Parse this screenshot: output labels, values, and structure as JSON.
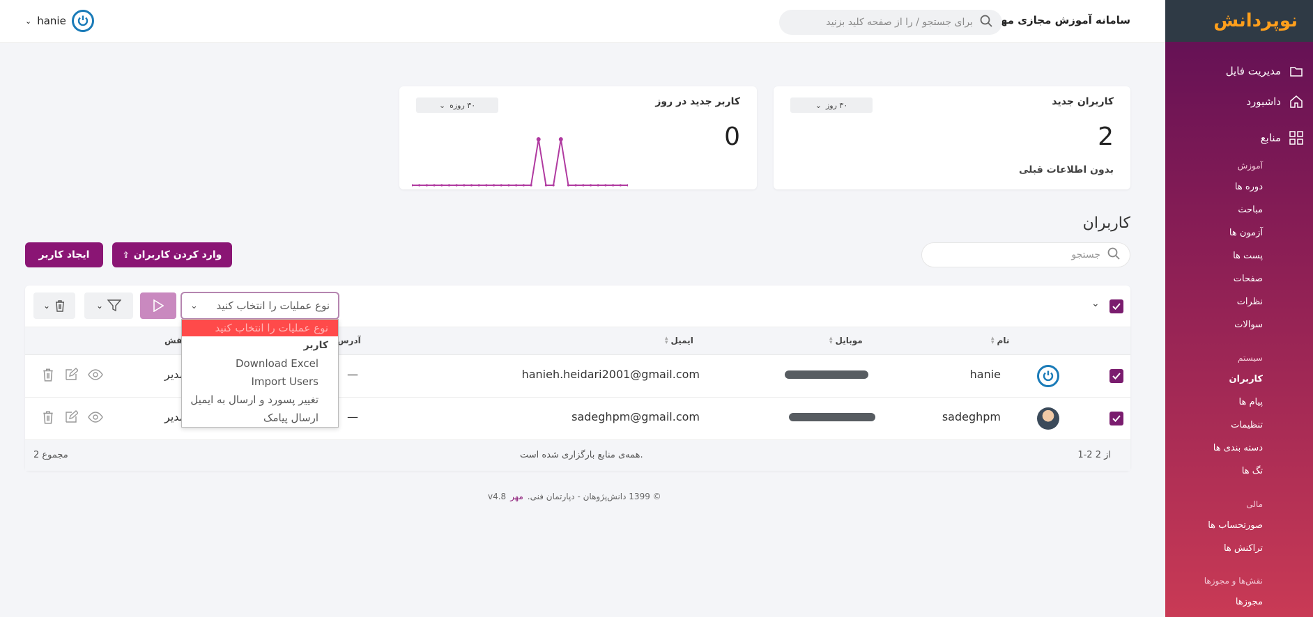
{
  "sidebar": {
    "logo_text": "نوپردانش",
    "main": [
      {
        "label": "مدیریت فایل",
        "icon": "folder-icon"
      },
      {
        "label": "داشبورد",
        "icon": "home-icon"
      },
      {
        "label": "منابع",
        "icon": "grid-icon"
      }
    ],
    "groups": [
      {
        "heading": "آموزش",
        "items": [
          "دوره ها",
          "مباحث",
          "آزمون ها",
          "پست ها",
          "صفحات",
          "نظرات",
          "سوالات"
        ]
      },
      {
        "heading": "سیستم",
        "items": [
          "کاربران",
          "پیام ها",
          "تنظیمات",
          "دسته بندی ها",
          "تگ ها"
        ]
      },
      {
        "heading": "مالی",
        "items": [
          "صورتحساب ها",
          "تراکنش ها"
        ]
      },
      {
        "heading": "نقش‌ها و مجوزها",
        "items": [
          "مجوزها"
        ]
      }
    ],
    "active_item": "کاربران"
  },
  "header": {
    "site_title": "سامانه آموزش مجازی مهر",
    "search_placeholder": "برای جستجو / را از صفحه کلید بزنید",
    "username": "hanie"
  },
  "stats": {
    "new_users": {
      "title": "کاربران جدید",
      "value": "2",
      "subtitle": "بدون اطلاعات قبلی",
      "period": "۳۰ روز"
    },
    "daily_users": {
      "title": "کاربر جدید در روز",
      "value": "0",
      "period": "۳۰ روزه"
    }
  },
  "chart_data": {
    "type": "line",
    "title": "کاربر جدید در روز",
    "x": [
      1,
      2,
      3,
      4,
      5,
      6,
      7,
      8,
      9,
      10,
      11,
      12,
      13,
      14,
      15,
      16,
      17,
      18,
      19,
      20,
      21,
      22,
      23,
      24,
      25,
      26,
      27,
      28,
      29,
      30
    ],
    "series": [
      {
        "values": [
          0,
          0,
          0,
          0,
          0,
          0,
          0,
          0,
          0,
          0,
          0,
          0,
          0,
          0,
          0,
          0,
          0,
          1,
          0,
          0,
          1,
          0,
          0,
          0,
          0,
          0,
          0,
          0,
          0,
          0
        ]
      }
    ],
    "color": "#b03aa0",
    "ylim": [
      0,
      1
    ]
  },
  "users_section": {
    "title": "کاربران",
    "search_placeholder": "جستجو",
    "create_button": "ایجاد کاربر",
    "import_button": "وارد کردن کاربران",
    "ops_placeholder": "نوع عملیات را انتخاب کنید"
  },
  "table": {
    "columns": {
      "name": "نام",
      "mobile": "موبایل",
      "email": "ایمیل",
      "address": "آدرس",
      "role": "نقش"
    },
    "rows": [
      {
        "name": "hanie",
        "email": "hanieh.heidari2001@gmail.com",
        "address": "—",
        "role": "مدیر"
      },
      {
        "name": "sadeghpm",
        "email": "sadeghpm@gmail.com",
        "address": "—",
        "role": "مدیر"
      }
    ],
    "range": "1-2 از 2",
    "loaded_text": "همه‌ی منابع بارگزاری شده است.",
    "total": "مجموع 2"
  },
  "dropdown": {
    "items": [
      {
        "label": "نوع عملیات را انتخاب کنید",
        "kind": "placeholder"
      },
      {
        "label": "کاربر",
        "kind": "group"
      },
      {
        "label": "Download Excel",
        "kind": "option"
      },
      {
        "label": "Import Users",
        "kind": "option"
      },
      {
        "label": "تغییر پسورد و ارسال به ایمیل",
        "kind": "option"
      },
      {
        "label": "ارسال پیامک",
        "kind": "option"
      }
    ]
  },
  "footer": {
    "copyright": "© 1399 دانش‌پژوهان - دپارتمان فنی.",
    "brand": "مهر",
    "version": "v4.8"
  }
}
